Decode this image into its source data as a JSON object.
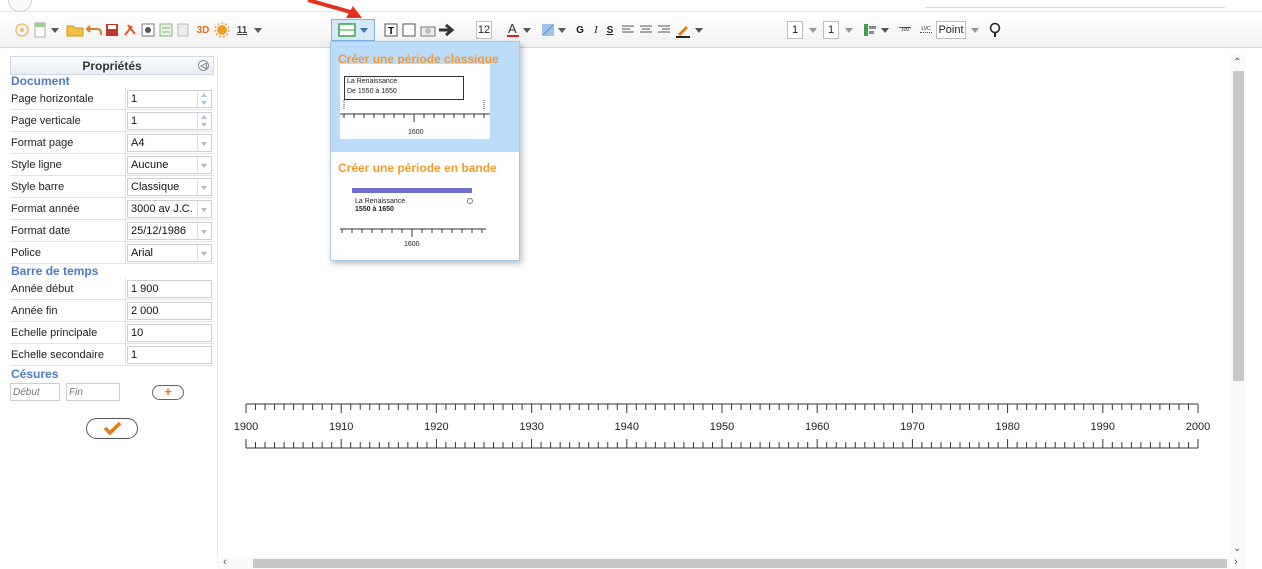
{
  "toolbar": {
    "btn_3d": "3D",
    "btn_calendar_num": "11",
    "font_size": "12",
    "btn_bold": "G",
    "btn_italic": "I",
    "btn_underline": "S",
    "line_width_1": "1",
    "line_width_2": "1",
    "unit_small": "100",
    "unit_lvc": "LVC",
    "unit_select": "Point",
    "accent_color": "#e5301f",
    "icons": [
      "new-icon",
      "page-icon",
      "open-folder-icon",
      "undo-icon",
      "save-icon",
      "tools-icon",
      "image-icon",
      "text-box-icon",
      "3d-icon",
      "sun-icon",
      "calendar-icon",
      "period-icon",
      "text-icon",
      "rectangle-icon",
      "camera-icon",
      "arrow-icon",
      "font-color-icon",
      "fill-icon",
      "align-left-icon",
      "align-center-icon",
      "align-right-icon",
      "pen-icon",
      "layers-icon",
      "lightbulb-icon"
    ]
  },
  "panel": {
    "title": "Propriétés",
    "document_section": "Document",
    "document_fields": [
      {
        "label": "Page horizontale",
        "value": "1",
        "kind": "spin"
      },
      {
        "label": "Page verticale",
        "value": "1",
        "kind": "spin"
      },
      {
        "label": "Format page",
        "value": "A4",
        "kind": "select"
      },
      {
        "label": "Style ligne",
        "value": "Aucune",
        "kind": "select"
      },
      {
        "label": "Style barre",
        "value": "Classique",
        "kind": "select"
      },
      {
        "label": "Format année",
        "value": "3000 av J.C.",
        "kind": "select"
      },
      {
        "label": "Format date",
        "value": "25/12/1986",
        "kind": "select"
      },
      {
        "label": "Police",
        "value": "Arial",
        "kind": "select"
      }
    ],
    "timebar_section": "Barre de temps",
    "timebar_fields": [
      {
        "label": "Année début",
        "value": "1 900"
      },
      {
        "label": "Année fin",
        "value": "2 000"
      },
      {
        "label": "Echelle principale",
        "value": "10"
      },
      {
        "label": "Echelle secondaire",
        "value": "1"
      }
    ],
    "cesures_section": "Césures",
    "cesure_start_placeholder": "Début",
    "cesure_end_placeholder": "Fin",
    "plus_label": "+"
  },
  "timeline": {
    "start": 1900,
    "end": 2000,
    "major_step": 10,
    "minor_step": 1,
    "labels": [
      "1900",
      "1910",
      "1920",
      "1930",
      "1940",
      "1950",
      "1960",
      "1970",
      "1980",
      "1990",
      "2000"
    ]
  },
  "popup": {
    "option1_title": "Créer une période classique",
    "option1_preview_line1": "La Renaissance",
    "option1_preview_line2": "De 1550 à 1650",
    "option1_preview_year": "1600",
    "option2_title": "Créer une période en bande",
    "option2_preview_line1": "La Renaissance",
    "option2_preview_line2": "1550 à 1650",
    "option2_preview_year": "1600",
    "band_color": "#6f6fd0",
    "title_color": "#f29a2e"
  }
}
